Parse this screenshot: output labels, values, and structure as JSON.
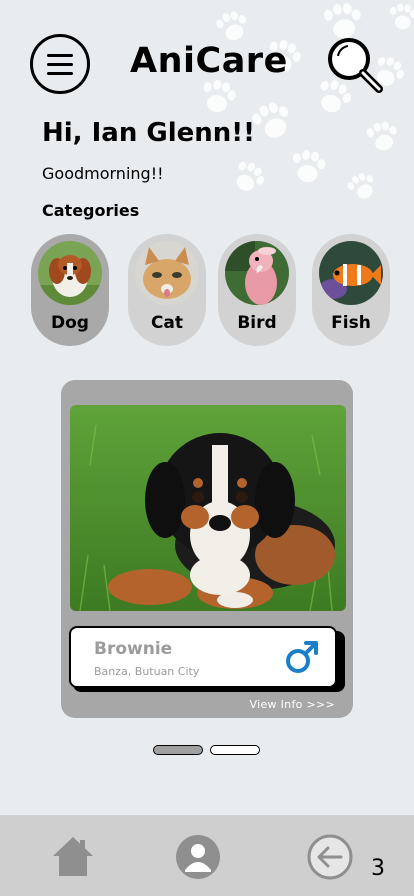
{
  "app": {
    "title": "AniCare"
  },
  "header": {
    "menu_icon": "hamburger-menu-icon",
    "search_icon": "search-icon"
  },
  "greeting": {
    "title": "Hi, Ian Glenn!!",
    "subtitle": "Goodmorning!!"
  },
  "categories": {
    "title": "Categories",
    "items": [
      {
        "label": "Dog",
        "icon": "dog-photo",
        "selected": true
      },
      {
        "label": "Cat",
        "icon": "cat-photo",
        "selected": false
      },
      {
        "label": "Bird",
        "icon": "bird-photo",
        "selected": false
      },
      {
        "label": "Fish",
        "icon": "fish-photo",
        "selected": false
      }
    ]
  },
  "pet_card": {
    "name": "Brownie",
    "location": "Banza, Butuan City",
    "gender": "male",
    "gender_icon": "male-symbol-icon",
    "view_info_label": "View Info >>>"
  },
  "carousel": {
    "current": 1,
    "total": 2
  },
  "bottom_nav": {
    "items": [
      {
        "icon": "home-icon"
      },
      {
        "icon": "profile-icon"
      },
      {
        "icon": "back-arrow-icon"
      }
    ]
  },
  "page_number": "3",
  "colors": {
    "background": "#e9ecef",
    "category_selected": "#a9a9a9",
    "category_default": "#d2d2d2",
    "card": "#a7a7a7",
    "gender_male": "#1a7fc9",
    "nav_bar": "#cfcfcf"
  }
}
